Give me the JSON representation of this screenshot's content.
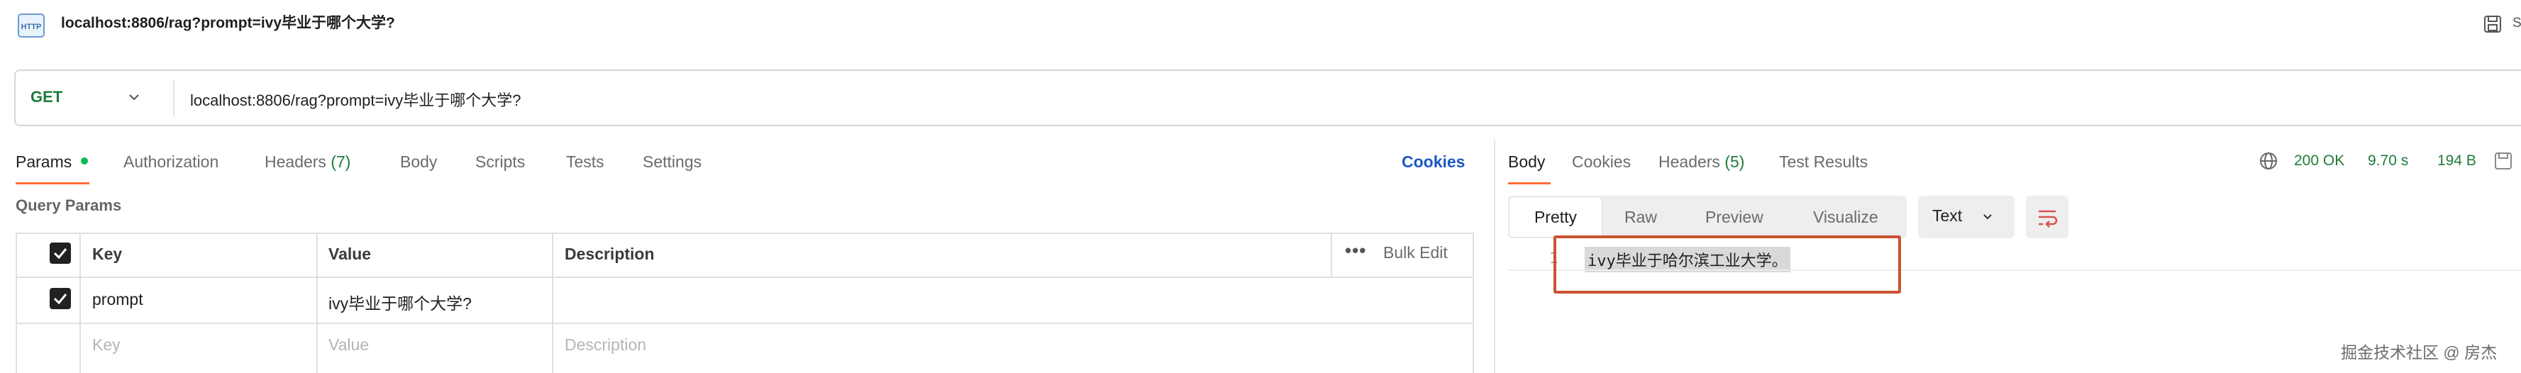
{
  "request": {
    "title": "localhost:8806/rag?prompt=ivy毕业于哪个大学?",
    "save_label": "S",
    "method": "GET",
    "url": "localhost:8806/rag?prompt=ivy毕业于哪个大学?"
  },
  "request_tabs": {
    "params": "Params",
    "authorization": "Authorization",
    "headers": "Headers",
    "headers_count": "(7)",
    "body": "Body",
    "scripts": "Scripts",
    "tests": "Tests",
    "settings": "Settings",
    "cookies": "Cookies"
  },
  "query_params": {
    "section_label": "Query Params",
    "columns": {
      "key": "Key",
      "value": "Value",
      "description": "Description"
    },
    "bulk_edit": "Bulk Edit",
    "rows": [
      {
        "checked": true,
        "key": "prompt",
        "value": "ivy毕业于哪个大学?",
        "description": ""
      }
    ],
    "placeholder": {
      "key": "Key",
      "value": "Value",
      "description": "Description"
    }
  },
  "response": {
    "tabs": {
      "body": "Body",
      "cookies": "Cookies",
      "headers": "Headers",
      "headers_count": "(5)",
      "test_results": "Test Results"
    },
    "status": "200 OK",
    "time": "9.70 s",
    "size": "194 B",
    "view_modes": [
      "Pretty",
      "Raw",
      "Preview",
      "Visualize"
    ],
    "active_view": "Pretty",
    "format": "Text",
    "line_number": "1",
    "body_text": "ivy毕业于哈尔滨工业大学。"
  },
  "watermark": "掘金技术社区 @ 房杰",
  "colors": {
    "accent": "#ff6c37",
    "method_green": "#1e7b3c",
    "link_blue": "#1a58c7",
    "highlight_box": "#c9532f",
    "status_green": "#1e7b3c"
  },
  "icons": [
    "http-icon",
    "save-icon",
    "chevron-down-icon",
    "checkbox-checked-icon",
    "more-icon",
    "globe-icon",
    "wrap-lines-icon"
  ]
}
